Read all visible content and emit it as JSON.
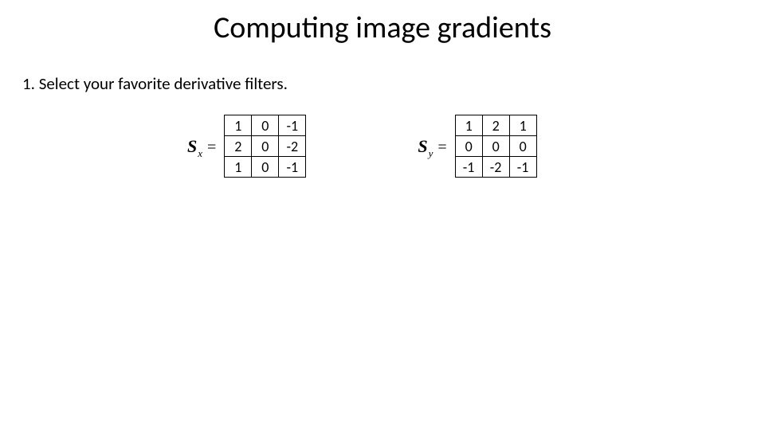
{
  "title": "Computing image gradients",
  "step_line": "1.   Select your favorite derivative filters.",
  "filters": {
    "sx": {
      "symbol": "S",
      "subscript": "x",
      "equals": "=",
      "matrix": [
        [
          "1",
          "0",
          "-1"
        ],
        [
          "2",
          "0",
          "-2"
        ],
        [
          "1",
          "0",
          "-1"
        ]
      ]
    },
    "sy": {
      "symbol": "S",
      "subscript": "y",
      "equals": "=",
      "matrix": [
        [
          "1",
          "2",
          "1"
        ],
        [
          "0",
          "0",
          "0"
        ],
        [
          "-1",
          "-2",
          "-1"
        ]
      ]
    }
  }
}
